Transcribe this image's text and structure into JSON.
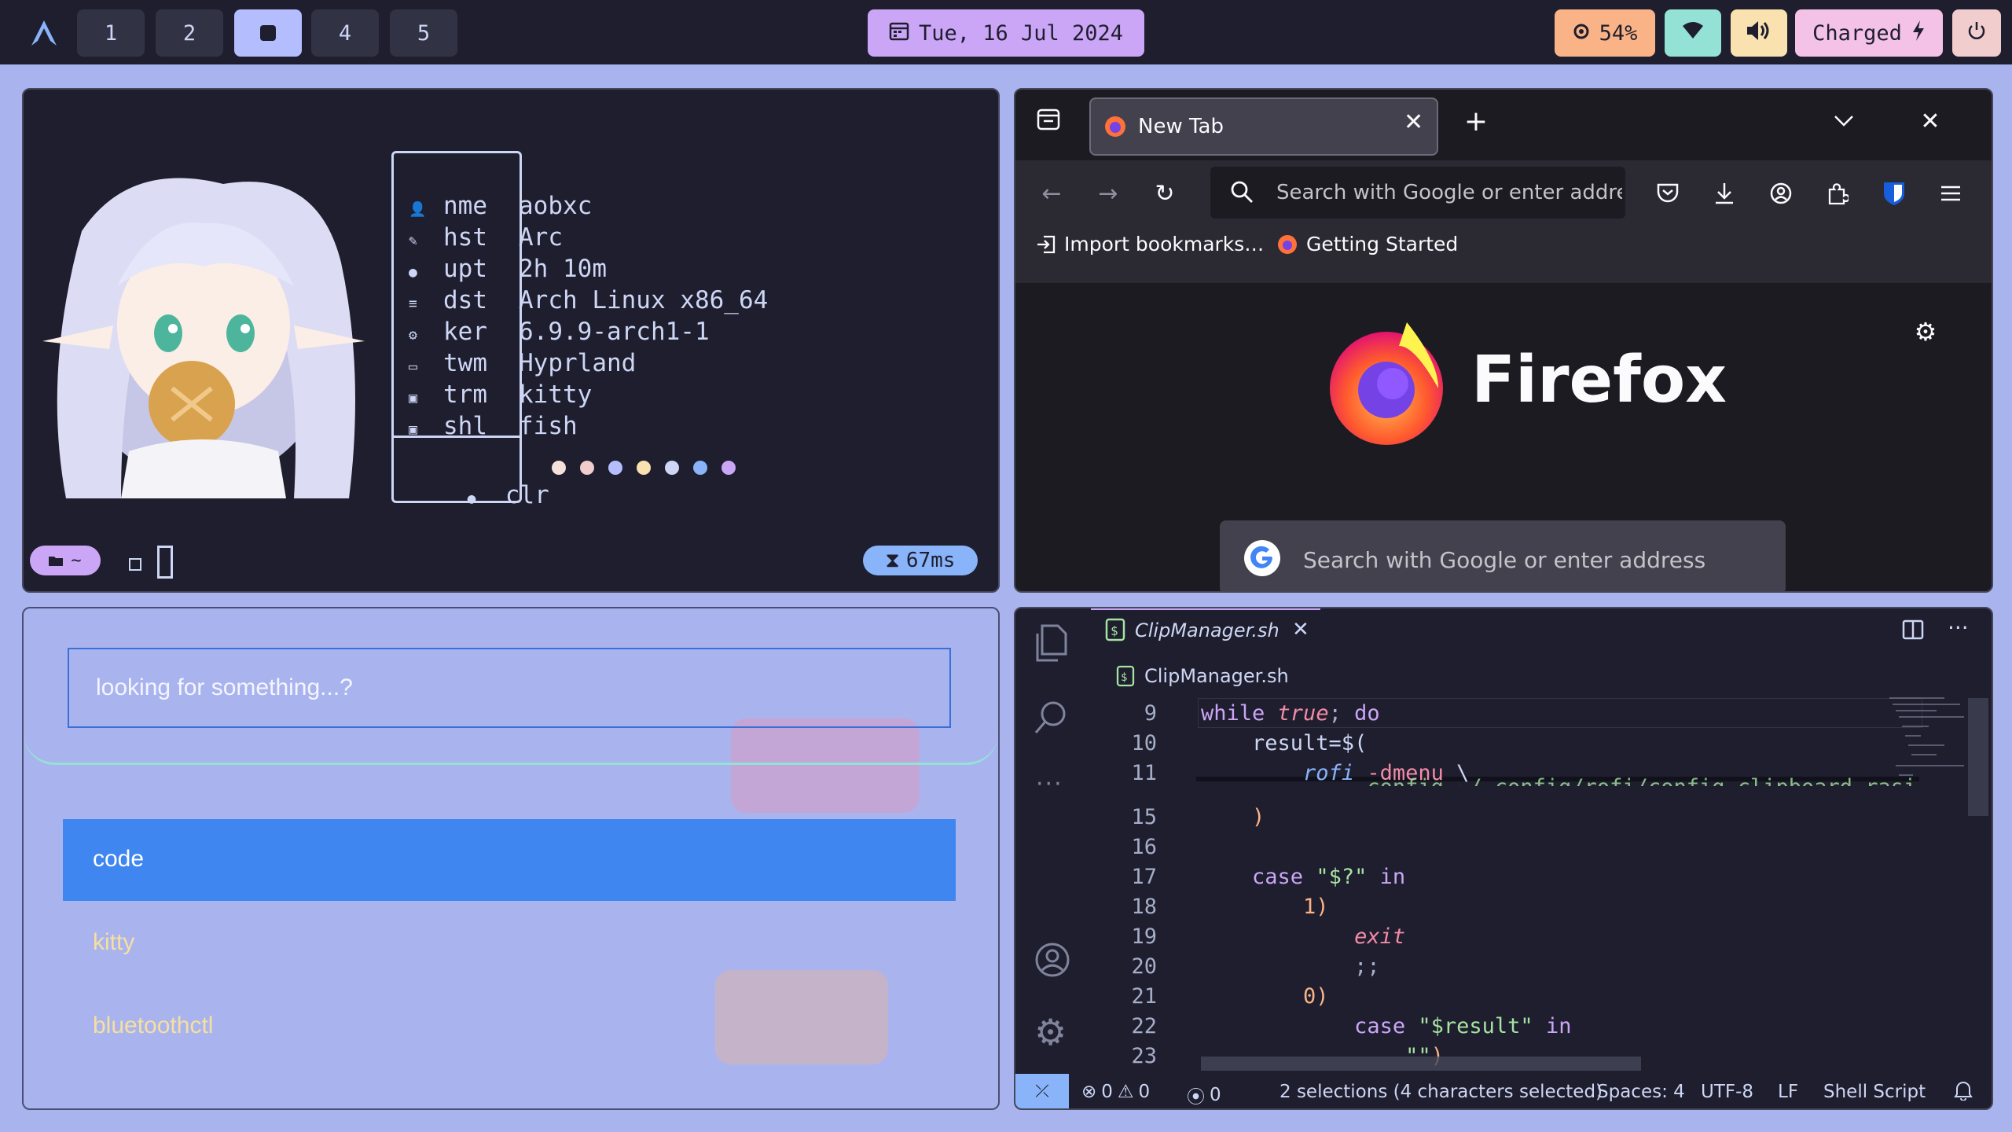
{
  "topbar": {
    "logo_icon": "arch-logo-icon",
    "workspaces": [
      "1",
      "2",
      "",
      "4",
      "5"
    ],
    "active_workspace": 3,
    "date": "Tue, 16 Jul 2024",
    "cpu": "54%",
    "battery": "Charged"
  },
  "terminal": {
    "rows": [
      {
        "icon": "user-icon",
        "key": "nme",
        "value": "aobxc"
      },
      {
        "icon": "pen-icon",
        "key": "hst",
        "value": "Arc"
      },
      {
        "icon": "dot-icon",
        "key": "upt",
        "value": "2h 10m"
      },
      {
        "icon": "lines-icon",
        "key": "dst",
        "value": "Arch Linux x86_64"
      },
      {
        "icon": "gear-icon",
        "key": "ker",
        "value": "6.9.9-arch1-1"
      },
      {
        "icon": "monitor-icon",
        "key": "twm",
        "value": "Hyprland"
      },
      {
        "icon": "terminal-icon",
        "key": "trm",
        "value": "kitty"
      },
      {
        "icon": "terminal-icon",
        "key": "shl",
        "value": "fish"
      }
    ],
    "clr_key": "clr",
    "palette": [
      "#f5e0dc",
      "#f2cdcd",
      "#b4befe",
      "#f9e2af",
      "#cdd6f4",
      "#89b4fa",
      "#cba6f7"
    ],
    "prompt_dir": "~",
    "duration": "67ms"
  },
  "firefox": {
    "tab_title": "New Tab",
    "url_placeholder": "Search with Google or enter address",
    "bookmarks": [
      "Import bookmarks…",
      "Getting Started"
    ],
    "brand": "Firefox",
    "search_placeholder": "Search with Google or enter address"
  },
  "rofi": {
    "placeholder": "looking for something...?",
    "items": [
      "code",
      "kitty",
      "bluetoothctl"
    ],
    "selected": 0
  },
  "vscode": {
    "tab": "ClipManager.sh",
    "breadcrumb": "ClipManager.sh",
    "line_numbers": [
      "9",
      "10",
      "11",
      "15",
      "16",
      "17",
      "18",
      "19",
      "20",
      "21",
      "22",
      "23"
    ],
    "statusbar": {
      "errors": "0",
      "warnings": "0",
      "ports": "0",
      "selection": "2 selections (4 characters selected)",
      "spaces": "Spaces: 4",
      "encoding": "UTF-8",
      "eol": "LF",
      "language": "Shell Script"
    }
  }
}
